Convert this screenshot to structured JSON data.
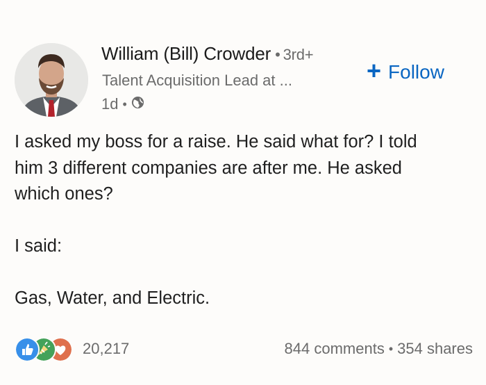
{
  "author": {
    "name": "William (Bill) Crowder",
    "degree": "3rd+",
    "headline": "Talent Acquisition Lead at ...",
    "time": "1d",
    "visibility_icon": "globe-icon"
  },
  "follow": {
    "icon": "plus-icon",
    "label": "Follow"
  },
  "post": {
    "line1": "I asked my boss for a raise. He said what for? I told",
    "line2": "him 3 different companies are after me. He asked",
    "line3": "which ones?",
    "line4": "I said:",
    "line5": "Gas, Water, and Electric."
  },
  "social": {
    "reaction_icons": [
      "like-icon",
      "celebrate-icon",
      "love-icon"
    ],
    "reaction_count": "20,217",
    "comments": "844 comments",
    "shares": "354 shares"
  },
  "colors": {
    "accent": "#0a66c2",
    "muted_text": "#6b6b6b",
    "background": "#fdfcfa"
  }
}
